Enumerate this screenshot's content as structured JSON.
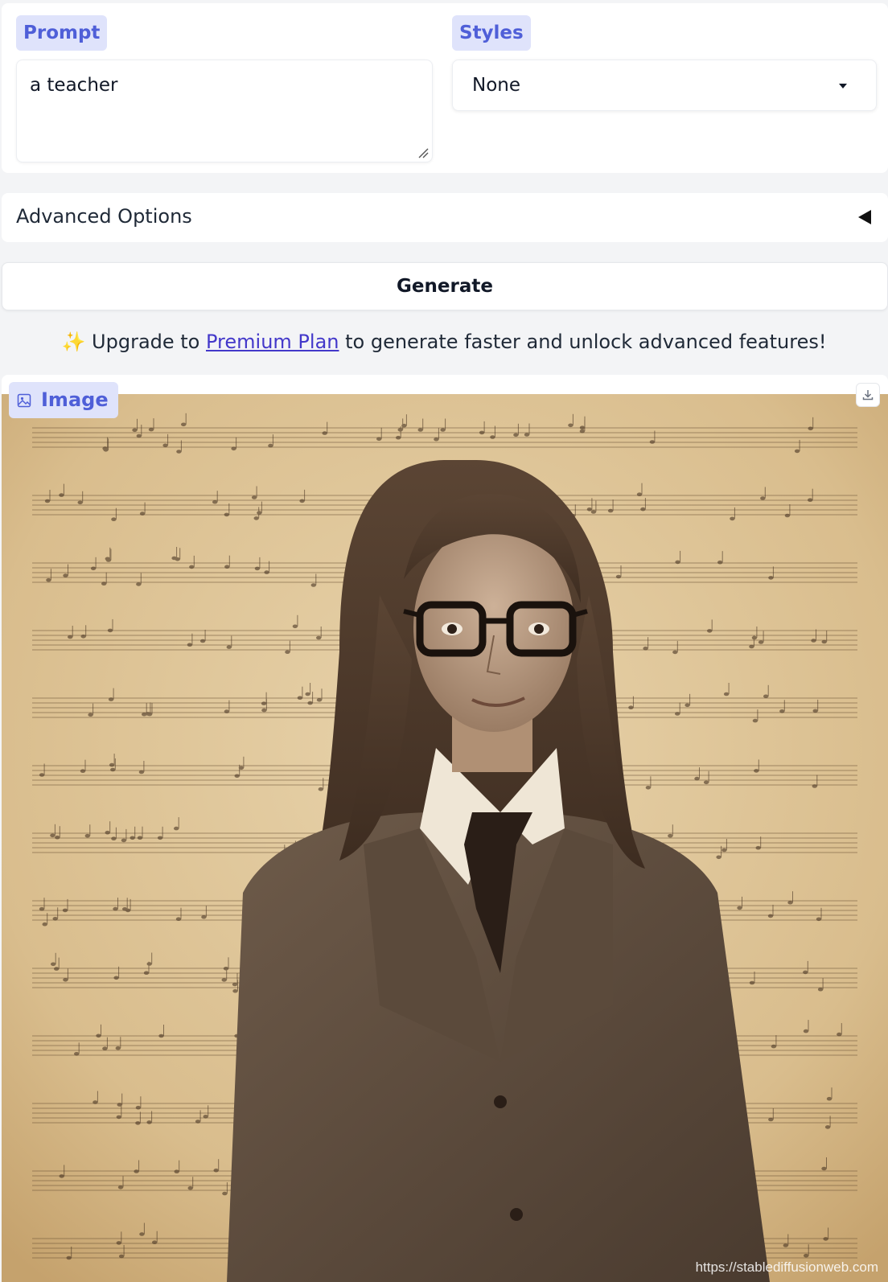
{
  "prompt": {
    "label": "Prompt",
    "value": "a teacher"
  },
  "styles": {
    "label": "Styles",
    "selected": "None",
    "caret_icon": "caret-down-icon"
  },
  "advanced": {
    "label": "Advanced Options",
    "toggle_icon": "triangle-left-icon"
  },
  "generate": {
    "label": "Generate"
  },
  "promo": {
    "emoji": "✨",
    "prefix": " Upgrade to ",
    "link_text": "Premium Plan",
    "suffix": " to generate faster and unlock advanced features!"
  },
  "output": {
    "label": "Image",
    "label_icon": "image-icon",
    "download_icon": "download-icon",
    "watermark": "https://stablediffusionweb.com"
  },
  "colors": {
    "accent": "#4f5fd8",
    "accent_bg": "#dfe3fb",
    "link": "#4338ca"
  }
}
